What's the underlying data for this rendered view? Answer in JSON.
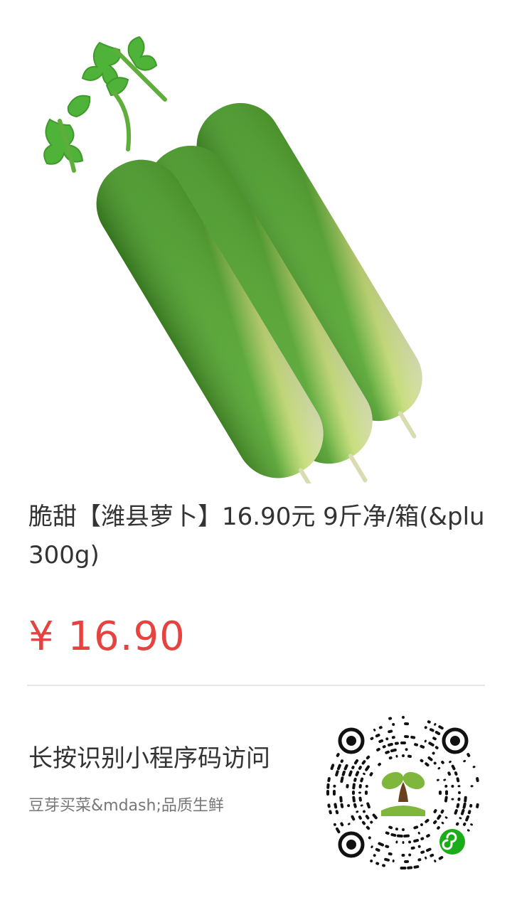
{
  "product": {
    "title_line1": "脆甜【潍县萝卜】16.90元 9斤净/箱(&plu",
    "title_line2": "300g)",
    "price": "¥ 16.90"
  },
  "share": {
    "scan_hint": "长按识别小程序码访问",
    "shop_name": "豆芽买菜&mdash;品质生鲜"
  },
  "icons": {
    "product_image": "green-radish-image",
    "qr_code": "mini-program-code",
    "qr_badge": "mini-program-logo-icon"
  },
  "colors": {
    "price": "#e64340",
    "title": "#333333",
    "subtitle": "#777777",
    "radish_green": "#4f9c2c",
    "radish_white": "#f3f6d2",
    "divider": "#e6e6e6"
  }
}
